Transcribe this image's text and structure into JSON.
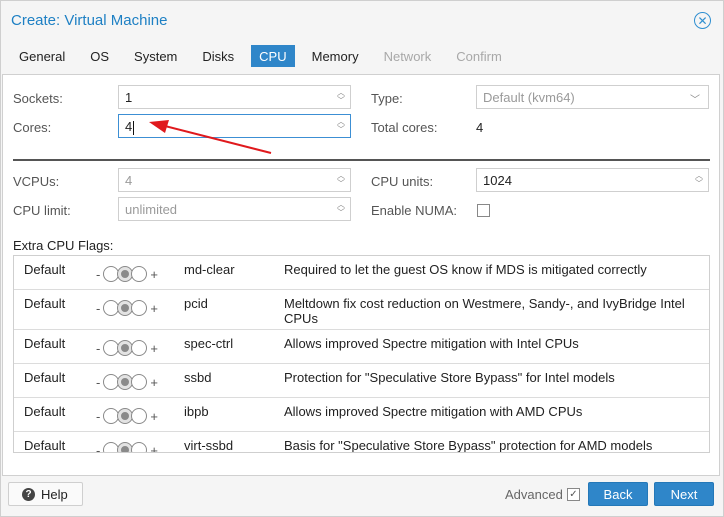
{
  "window": {
    "title": "Create: Virtual Machine",
    "close_symbol": "✕"
  },
  "tabs": [
    {
      "label": "General",
      "state": "normal"
    },
    {
      "label": "OS",
      "state": "normal"
    },
    {
      "label": "System",
      "state": "normal"
    },
    {
      "label": "Disks",
      "state": "normal"
    },
    {
      "label": "CPU",
      "state": "active"
    },
    {
      "label": "Memory",
      "state": "normal"
    },
    {
      "label": "Network",
      "state": "disabled"
    },
    {
      "label": "Confirm",
      "state": "disabled"
    }
  ],
  "form": {
    "sockets_label": "Sockets:",
    "sockets_value": "1",
    "cores_label": "Cores:",
    "cores_value": "4",
    "type_label": "Type:",
    "type_value": "Default (kvm64)",
    "total_cores_label": "Total cores:",
    "total_cores_value": "4",
    "vcpus_label": "VCPUs:",
    "vcpus_value": "4",
    "cpu_limit_label": "CPU limit:",
    "cpu_limit_value": "unlimited",
    "cpu_units_label": "CPU units:",
    "cpu_units_value": "1024",
    "numa_label": "Enable NUMA:",
    "numa_checked": false
  },
  "flags": {
    "heading": "Extra CPU Flags:",
    "minus": "-",
    "plus": "+",
    "rows": [
      {
        "state": "Default",
        "flag": "md-clear",
        "desc": "Required to let the guest OS know if MDS is mitigated correctly"
      },
      {
        "state": "Default",
        "flag": "pcid",
        "desc": "Meltdown fix cost reduction on Westmere, Sandy-, and IvyBridge Intel CPUs"
      },
      {
        "state": "Default",
        "flag": "spec-ctrl",
        "desc": "Allows improved Spectre mitigation with Intel CPUs"
      },
      {
        "state": "Default",
        "flag": "ssbd",
        "desc": "Protection for \"Speculative Store Bypass\" for Intel models"
      },
      {
        "state": "Default",
        "flag": "ibpb",
        "desc": "Allows improved Spectre mitigation with AMD CPUs"
      },
      {
        "state": "Default",
        "flag": "virt-ssbd",
        "desc": "Basis for \"Speculative Store Bypass\" protection for AMD models"
      }
    ]
  },
  "footer": {
    "help_label": "Help",
    "help_icon": "?",
    "advanced_label": "Advanced",
    "advanced_checked": true,
    "back_label": "Back",
    "next_label": "Next"
  },
  "colors": {
    "accent": "#2f86c9",
    "title": "#1e80c4",
    "annotation_arrow": "#e0191d"
  }
}
